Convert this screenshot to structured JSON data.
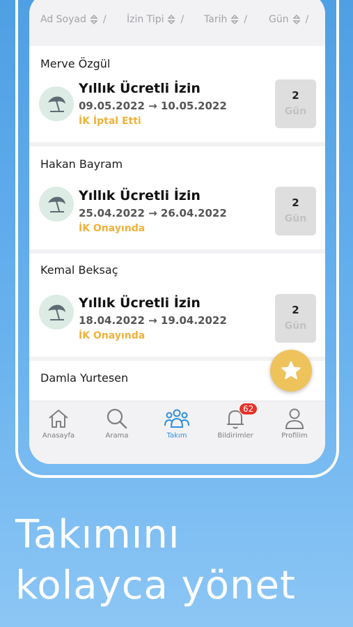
{
  "sort_bar": {
    "columns": [
      {
        "label": "Ad Soyad"
      },
      {
        "label": "İzin Tipi"
      },
      {
        "label": "Tarih"
      },
      {
        "label": "Gün"
      }
    ],
    "separator": "/"
  },
  "leaves": [
    {
      "name": "Merve Özgül",
      "type": "Yıllık Ücretli İzin",
      "dates": "09.05.2022 → 10.05.2022",
      "status": "İK İptal Etti",
      "days": "2",
      "unit": "Gün"
    },
    {
      "name": "Hakan Bayram",
      "type": "Yıllık Ücretli İzin",
      "dates": "25.04.2022 → 26.04.2022",
      "status": "İK Onayında",
      "days": "2",
      "unit": "Gün"
    },
    {
      "name": "Kemal Beksaç",
      "type": "Yıllık Ücretli İzin",
      "dates": "18.04.2022 → 19.04.2022",
      "status": "İK Onayında",
      "days": "2",
      "unit": "Gün"
    },
    {
      "name": "Damla Yurtesen"
    }
  ],
  "tabbar": {
    "tabs": [
      {
        "label": "Anasayfa",
        "icon": "home-icon"
      },
      {
        "label": "Arama",
        "icon": "search-icon"
      },
      {
        "label": "Takım",
        "icon": "team-icon"
      },
      {
        "label": "Bildirimler",
        "icon": "bell-icon"
      },
      {
        "label": "Profilim",
        "icon": "user-icon"
      }
    ],
    "notification_count": "62"
  },
  "headline": {
    "line1": "Takımını",
    "line2": "kolayca yönet"
  },
  "colors": {
    "accent": "#2f8ee0",
    "status": "#f0b23a",
    "fab": "#efc35c",
    "badge": "#e5332a"
  }
}
